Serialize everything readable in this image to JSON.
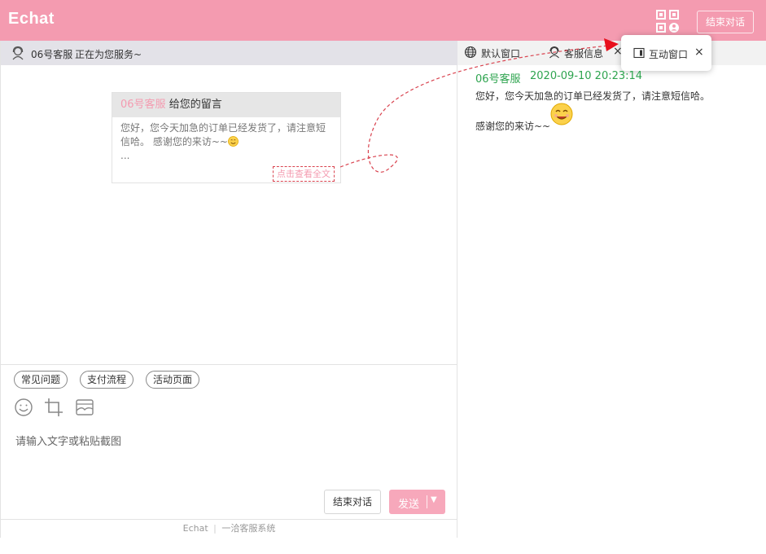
{
  "app": {
    "logo": "Echat"
  },
  "header": {
    "end_chat": "结束对话"
  },
  "agent_bar": {
    "name": "06号客服",
    "status": "正在为您服务~"
  },
  "message_card": {
    "sender": "06号客服",
    "title": "给您的留言",
    "body_line1": "您好，您今天加急的订单已经发货了，请注意短",
    "body_line2": "信哈。 感谢您的来访~~",
    "ellipsis": "...",
    "view_full": "点击查看全文"
  },
  "quick_replies": [
    "常见问题",
    "支付流程",
    "活动页面"
  ],
  "composer": {
    "placeholder": "请输入文字或粘贴截图",
    "end_chat": "结束对话",
    "send": "发送"
  },
  "footer": {
    "brand": "Echat",
    "sep": "|",
    "tagline": "一洽客服系统"
  },
  "tabs": {
    "default_window": "默认窗口",
    "agent_info": "客服信息",
    "interactive_window": "互动窗口"
  },
  "right_message": {
    "sender": "06号客服",
    "time": "2020-09-10 20:23:14",
    "line1": "您好，您今天加急的订单已经发货了，请注意短信哈。",
    "line2": "感谢您的来访~~"
  },
  "colors": {
    "brand": "#f49bb0",
    "send_button": "#f7a8bb",
    "agent_green": "#2ea44f",
    "annotation_red": "#d9434f"
  }
}
